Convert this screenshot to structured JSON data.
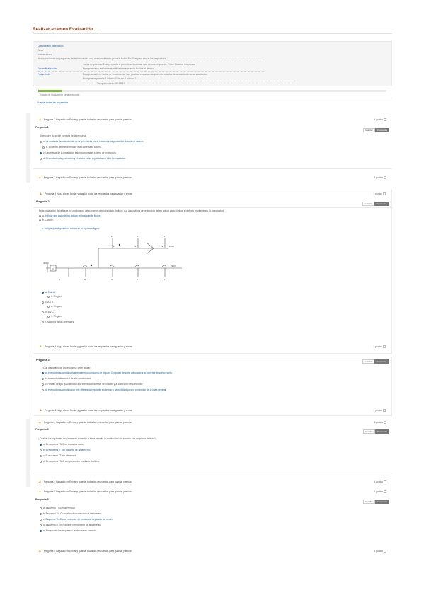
{
  "page": {
    "title": "Realizar examen Evaluación ..."
  },
  "info": {
    "lines": [
      "Cuestionario informativo",
      "Tarea",
      "Instrucciones",
      "Responda todas las preguntas de la evaluación; una vez completada, pulse el botón Finalizar para enviar las respuestas.",
      "Varias respuestas: Esta pregunta le permite seleccionar más de una respuesta. Pulse Guardar respuesta.",
      "Forzar finalización",
      "Esta prueba se enviará automáticamente cuando finalice el tiempo.",
      "Fecha límite",
      "Esta prueba tiene fecha de vencimiento. Las pruebas enviadas después de la fecha de vencimiento no se aceptarán.",
      "Esta prueba permite 1 intento. Este es el intento 1.",
      "Tiempo restante: 00:58:17"
    ]
  },
  "progress": {
    "label": "Estado de finalización de la pregunta:",
    "fraction": 0.07,
    "link": "Guardar todas las respuestas"
  },
  "questions": [
    {
      "head": "Pregunta 1  Haga clic en Enviar y guardar todas las respuestas para guardar y enviar.",
      "pager": "1 puntos",
      "label": "Pregunta 1",
      "save": "Guardar",
      "saved": "Respuesta",
      "prompt": "Seleccione la opción correcta de la pregunta:",
      "options": [
        "a. La corriente de cortocircuito es la que circula por el conductor de protección durante el defecto.",
        "b. El neutro del transformador está conectado a tierra.",
        "c. Las masas de la instalación están conectadas a tierra de protección.",
        "d. El conductor de protección y el neutro están separados en toda la instalación."
      ],
      "selected": 2,
      "foot": "Pregunta 1  Haga clic en Enviar y guardar todas las respuestas para guardar y enviar."
    },
    {
      "head": "Pregunta 2  Haga clic en Enviar y guardar todas las respuestas para guardar y enviar.",
      "pager": "1 puntos",
      "label": "Pregunta 2",
      "save": "Guardar",
      "saved": "Respuesta",
      "prompt": "En la instalación de la figura, se produce un defecto en el punto indicado. Indique qué dispositivos de protección deben actuar para eliminar el defecto manteniendo la selectividad.",
      "sub1": "a. Indique qué dispositivos actúan en la siguiente figura:",
      "sub2": "b. Calcule:",
      "options": [
        "a. Solo A",
        "b. Ninguno",
        "c. A y B",
        "d. B y C",
        "e. Ninguno",
        "f. A, B y C",
        "g. B, C y D",
        "h. Ninguno",
        "i. Ninguna de las anteriores"
      ],
      "selected": 0,
      "diagram_labels": [
        "A",
        "B",
        "C",
        "D",
        "E",
        "F",
        "G",
        "H",
        "400 V",
        "230V",
        "M"
      ],
      "foot": "Pregunta 2  Haga clic en Enviar y guardar todas las respuestas para guardar y enviar."
    },
    {
      "head": "Pregunta 3",
      "pager": "1 puntos",
      "label": "Pregunta 3",
      "save": "Guardar",
      "saved": "Respuesta",
      "prompt": "¿Qué dispositivo de protección se debe utilizar?",
      "options": [
        "a. Interruptor automático magnetotérmico con curva de disparo C y poder de corte adecuado a la corriente de cortocircuito.",
        "b. Interruptor diferencial de alta sensibilidad.",
        "c. Fusible de tipo gG calibrado a la intensidad nominal del circuito y a la sección del conductor.",
        "d. Interruptor automático con relé diferencial regulable en tiempo y sensibilidad para la protección de la línea general."
      ],
      "selected": 0,
      "foot": "Pregunta 3  Haga clic en Enviar y guardar todas las respuestas para guardar y enviar."
    },
    {
      "head": "Pregunta 4  Haga clic en Enviar y guardar todas las respuestas para guardar y enviar.",
      "pager": "1 puntos",
      "label": "Pregunta 4",
      "save": "Guardar",
      "saved": "Respuesta",
      "prompt": "¿Cuál de los siguientes esquemas de conexión a tierra permite la continuidad del servicio tras un primer defecto?",
      "options": [
        "a. El esquema TN-S en todos los casos.",
        "b. El esquema IT con vigilante de aislamiento.",
        "c. El esquema TT sin diferencial.",
        "d. El esquema TN-C con protección mediante fusibles."
      ],
      "selected": 0,
      "foot": "Pregunta 4  Haga clic en Enviar y guardar todas las respuestas para guardar y enviar."
    },
    {
      "head": "Pregunta 5  Haga clic en Enviar y guardar todas las respuestas para guardar y enviar.",
      "pager": "1 puntos",
      "label": "Pregunta 5",
      "save": "Guardar",
      "saved": "Respuesta",
      "options": [
        "a. Esquema TT con diferencial.",
        "b. Esquema TN-C con el neutro conectado a las masas.",
        "c. Esquema TN-S con conductor de protección separado del neutro.",
        "d. Esquema IT con vigilante permanente de aislamiento.",
        "e. Ninguno de los esquemas anteriores es correcto."
      ],
      "selected": 4,
      "foot": "Pregunta 5  Haga clic en Enviar y guardar todas las respuestas para guardar y enviar."
    }
  ],
  "colors": {
    "accent": "#1a5fa8",
    "title": "#8a3a1a",
    "progress": "#7dbd3a",
    "warning": "#e09a1c"
  },
  "icons": {
    "warning": "warning-icon",
    "pager": "page-box-icon"
  }
}
